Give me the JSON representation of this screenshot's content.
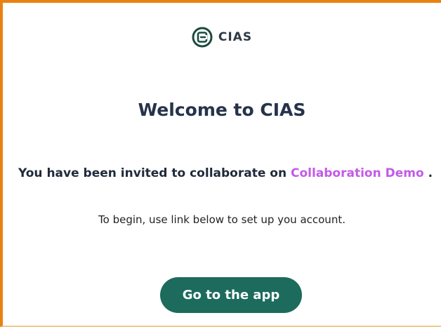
{
  "logo": {
    "icon": "cias-logo-icon",
    "text": "CIAS",
    "color": "#1c4a3e"
  },
  "title": "Welcome to CIAS",
  "invite": {
    "prefix": "You have been invited to collaborate on ",
    "project": "Collaboration Demo",
    "suffix": " .",
    "project_color": "#c25ae8"
  },
  "subtitle": "To begin, use link below to set up you account.",
  "cta": {
    "label": "Go to the app",
    "color": "#1c6b5c"
  }
}
